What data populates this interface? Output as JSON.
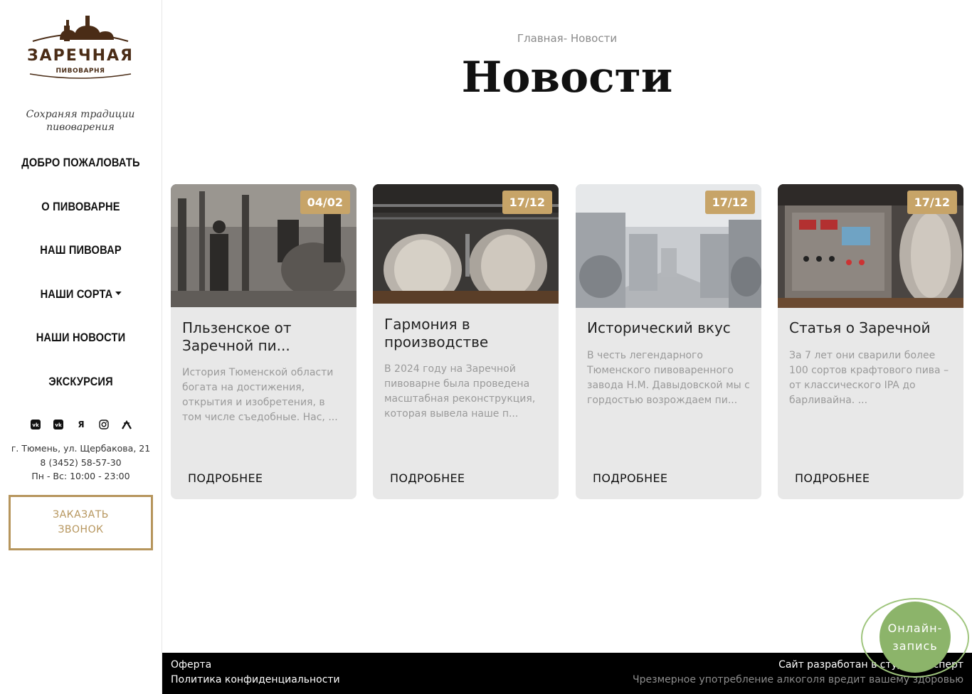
{
  "sidebar": {
    "logo": {
      "name": "ЗАРЕЧНАЯ",
      "sub": "ПИВОВАРНЯ"
    },
    "slogan": "Сохраняя традиции пивоварения",
    "nav": [
      {
        "label": "ДОБРО ПОЖАЛОВАТЬ"
      },
      {
        "label": "О ПИВОВАРНЕ"
      },
      {
        "label": "НАШ ПИВОВАР"
      },
      {
        "label": "НАШИ СОРТА"
      },
      {
        "label": "НАШИ НОВОСТИ"
      },
      {
        "label": "ЭКСКУРСИЯ"
      }
    ],
    "socials": [
      {
        "icon": "vk-icon",
        "glyph": ""
      },
      {
        "icon": "vk-icon",
        "glyph": ""
      },
      {
        "icon": "yandex-icon",
        "glyph": "Я"
      },
      {
        "icon": "instagram-icon",
        "glyph": ""
      },
      {
        "icon": "tripadvisor-icon",
        "glyph": ""
      }
    ],
    "address": "г. Тюмень, ул. Щербакова, 21",
    "phone": "8 (3452) 58-57-30",
    "hours": "Пн - Вс: 10:00 - 23:00",
    "callback_line1": "ЗАКАЗАТЬ",
    "callback_line2": "ЗВОНОК"
  },
  "main": {
    "breadcrumb": "Главная- Новости",
    "title": "Новости",
    "more_label": "ПОДРОБНЕЕ",
    "cards": [
      {
        "date": "04/02",
        "title": "Пльзенское от Заречной пи...",
        "text": "История Тюменской области богата на достижения, открытия и изобретения, в том числе съедобные. Нас, ..."
      },
      {
        "date": "17/12",
        "title": "Гармония в производстве",
        "text": "В 2024 году на Заречной пивоварне была проведена масштабная реконструкция, которая вывела наше п..."
      },
      {
        "date": "17/12",
        "title": "Исторический вкус",
        "text": "В честь легендарного Тюменского пивоваренного завода Н.М. Давыдовской мы с гордостью возрождаем пи..."
      },
      {
        "date": "17/12",
        "title": "Статья о Заречной",
        "text": "За 7 лет они сварили более 100 сортов крафтового пива – от классического IPA до барливайна. ..."
      }
    ]
  },
  "footer": {
    "offer": "Оферта",
    "privacy": "Политика конфиденциальности",
    "developer": "Сайт разработан в студии Эксперт",
    "warning": "Чрезмерное употребление алкоголя вредит вашему здоровью"
  },
  "online": {
    "line1": "Онлайн-",
    "line2": "запись"
  },
  "colors": {
    "accent": "#c7a468",
    "brand_brown": "#4a2c16",
    "online_green": "#8cb46a",
    "card_bg": "#e8e8e8"
  }
}
